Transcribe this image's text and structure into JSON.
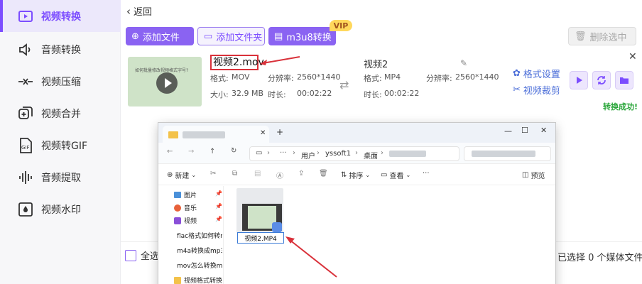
{
  "sidebar": {
    "items": [
      {
        "label": "视频转换",
        "icon": "video-convert-icon",
        "active": true
      },
      {
        "label": "音频转换",
        "icon": "audio-convert-icon"
      },
      {
        "label": "视频压缩",
        "icon": "compress-icon"
      },
      {
        "label": "视频合并",
        "icon": "merge-icon"
      },
      {
        "label": "视频转GIF",
        "icon": "gif-icon"
      },
      {
        "label": "音频提取",
        "icon": "waveform-icon"
      },
      {
        "label": "视频水印",
        "icon": "watermark-icon"
      }
    ]
  },
  "header": {
    "back_label": "返回"
  },
  "toolbar": {
    "add_file": "添加文件",
    "add_folder": "添加文件夹",
    "m3u8": "m3u8转换",
    "vip": "VIP",
    "delete_selected": "删除选中"
  },
  "file": {
    "thumb_text": "如何批量修改视频格式字号?",
    "source": {
      "name": "视频2.mov",
      "format_label": "格式:",
      "format": "MOV",
      "resolution_label": "分辨率:",
      "resolution": "2560*1440",
      "size_label": "大小:",
      "size": "32.9 MB",
      "duration_label": "时长:",
      "duration": "00:02:22"
    },
    "target": {
      "name": "视频2",
      "format_label": "格式:",
      "format": "MP4",
      "resolution_label": "分辨率:",
      "resolution": "2560*1440",
      "duration_label": "时长:",
      "duration": "00:02:22"
    },
    "format_settings": "格式设置",
    "video_crop": "视频裁剪",
    "status": "转换成功!"
  },
  "bottom": {
    "select_all": "全选",
    "selected_count": "已选择 0 个媒体文件"
  },
  "explorer": {
    "path": [
      "用户",
      "yssoft1",
      "桌面"
    ],
    "toolbar": {
      "new": "新建",
      "sort": "排序",
      "view": "查看",
      "preview": "预览"
    },
    "nav_items": [
      "图片",
      "音乐",
      "视频",
      "flac格式如何转m",
      "m4a转换成mp3",
      "mov怎么转换m",
      "视频格式转换"
    ],
    "file_label": "视频2.MP4"
  },
  "colors": {
    "accent": "#8a63f2",
    "success": "#2aa63a",
    "annotation_red": "#d9313a",
    "link": "#4a6dd8"
  }
}
